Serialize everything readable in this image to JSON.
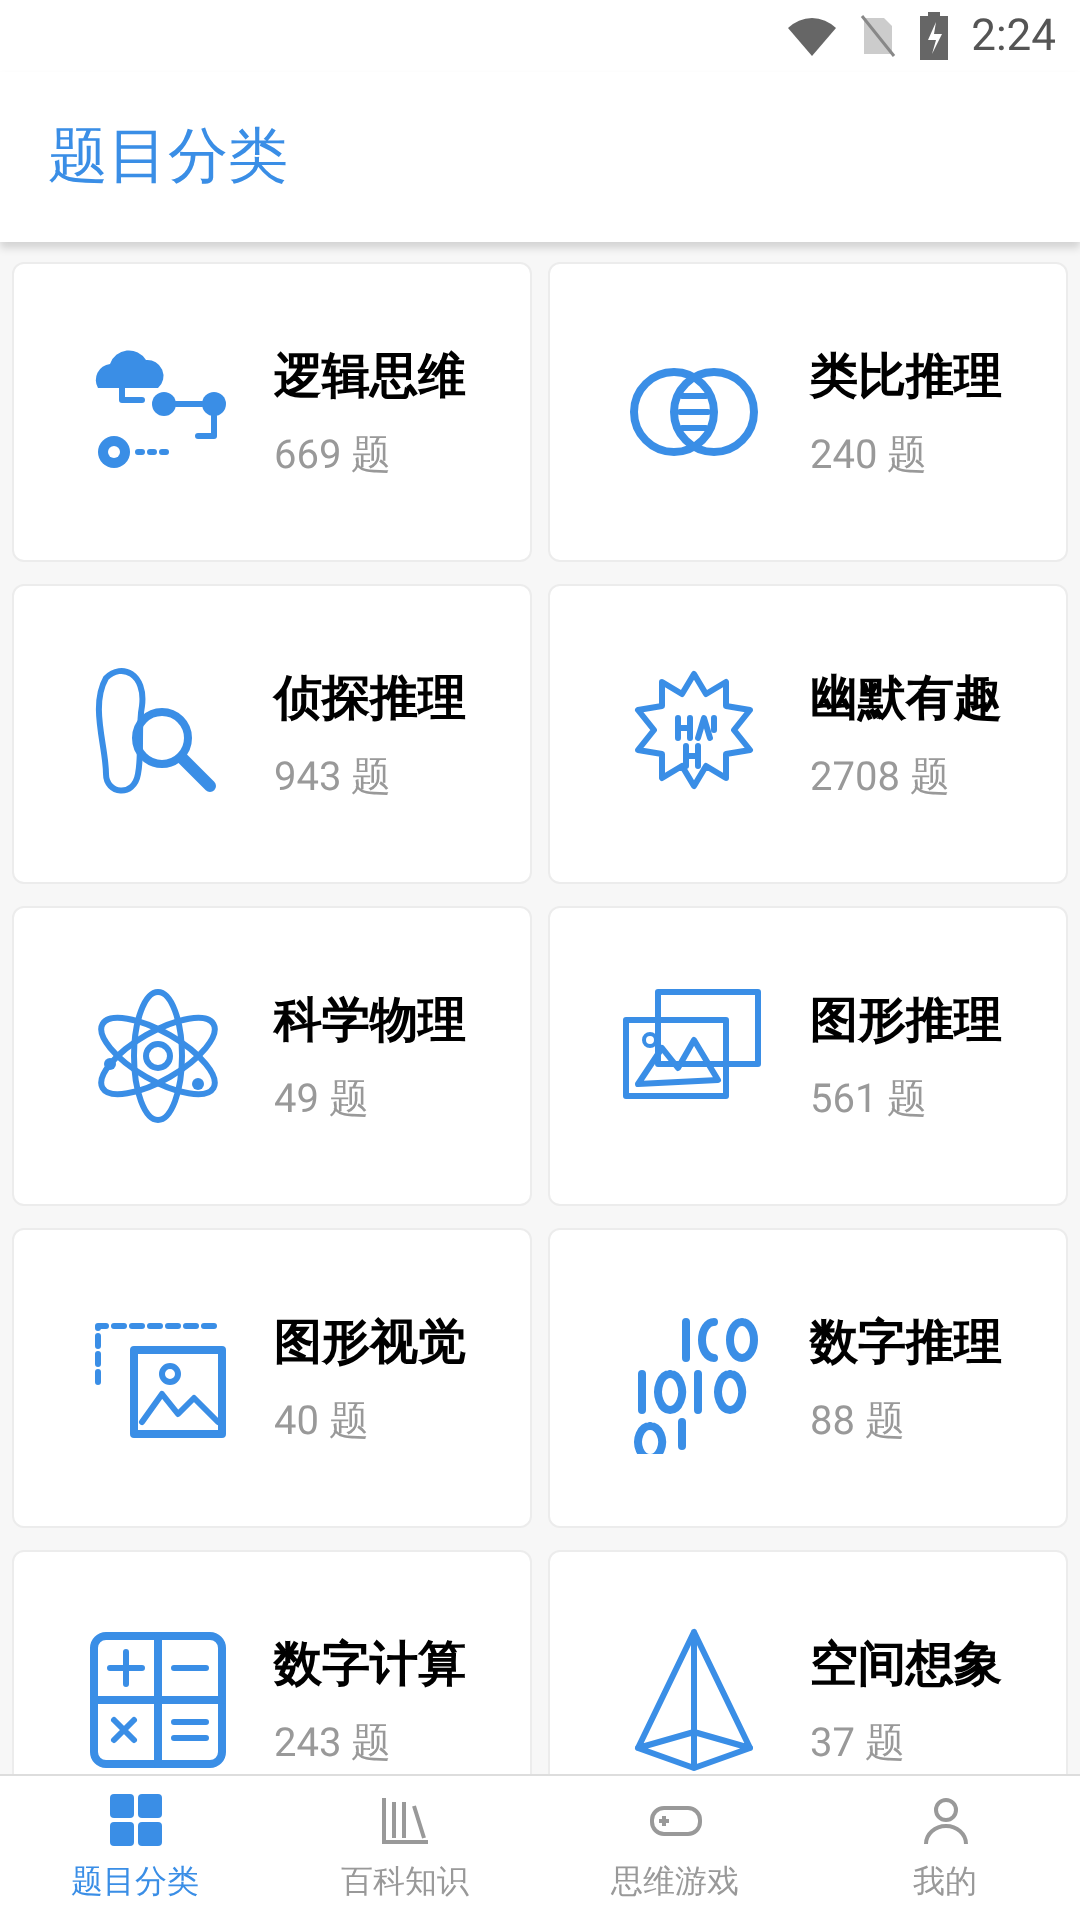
{
  "status_bar": {
    "time": "2:24"
  },
  "header": {
    "title": "题目分类"
  },
  "categories": [
    {
      "name": "逻辑思维",
      "count": "669 题"
    },
    {
      "name": "类比推理",
      "count": "240 题"
    },
    {
      "name": "侦探推理",
      "count": "943 题"
    },
    {
      "name": "幽默有趣",
      "count": "2708 题"
    },
    {
      "name": "科学物理",
      "count": "49 题"
    },
    {
      "name": "图形推理",
      "count": "561 题"
    },
    {
      "name": "图形视觉",
      "count": "40 题"
    },
    {
      "name": "数字推理",
      "count": "88 题"
    },
    {
      "name": "数字计算",
      "count": "243 题"
    },
    {
      "name": "空间想象",
      "count": "37 题"
    }
  ],
  "bottom_nav": [
    {
      "label": "题目分类",
      "selected": true
    },
    {
      "label": "百科知识",
      "selected": false
    },
    {
      "label": "思维游戏",
      "selected": false
    },
    {
      "label": "我的",
      "selected": false
    }
  ]
}
